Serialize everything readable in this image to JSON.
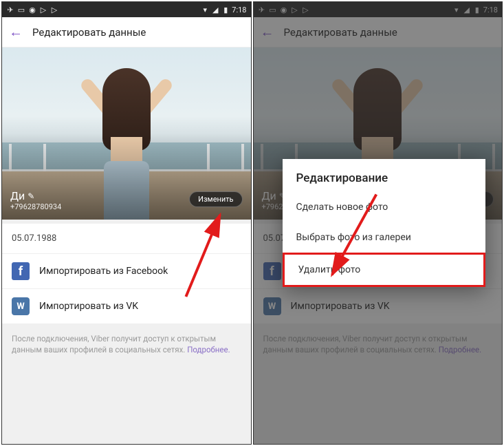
{
  "statusbar": {
    "time": "7:18"
  },
  "appbar": {
    "title": "Редактировать данные"
  },
  "profile": {
    "name": "Ди",
    "phone": "+79628780934",
    "change_btn": "Изменить",
    "birthday": "05.07.1988"
  },
  "imports": {
    "facebook": "Импортировать из Facebook",
    "vk": "Импортировать из VK"
  },
  "footer": {
    "text": "После подключения, Viber получит доступ к открытым данным ваших профилей в социальных сетях.",
    "more": "Подробнее."
  },
  "dialog": {
    "title": "Редактирование",
    "item1": "Сделать новое фото",
    "item2": "Выбрать фото из галереи",
    "item3": "Удалить фото"
  }
}
